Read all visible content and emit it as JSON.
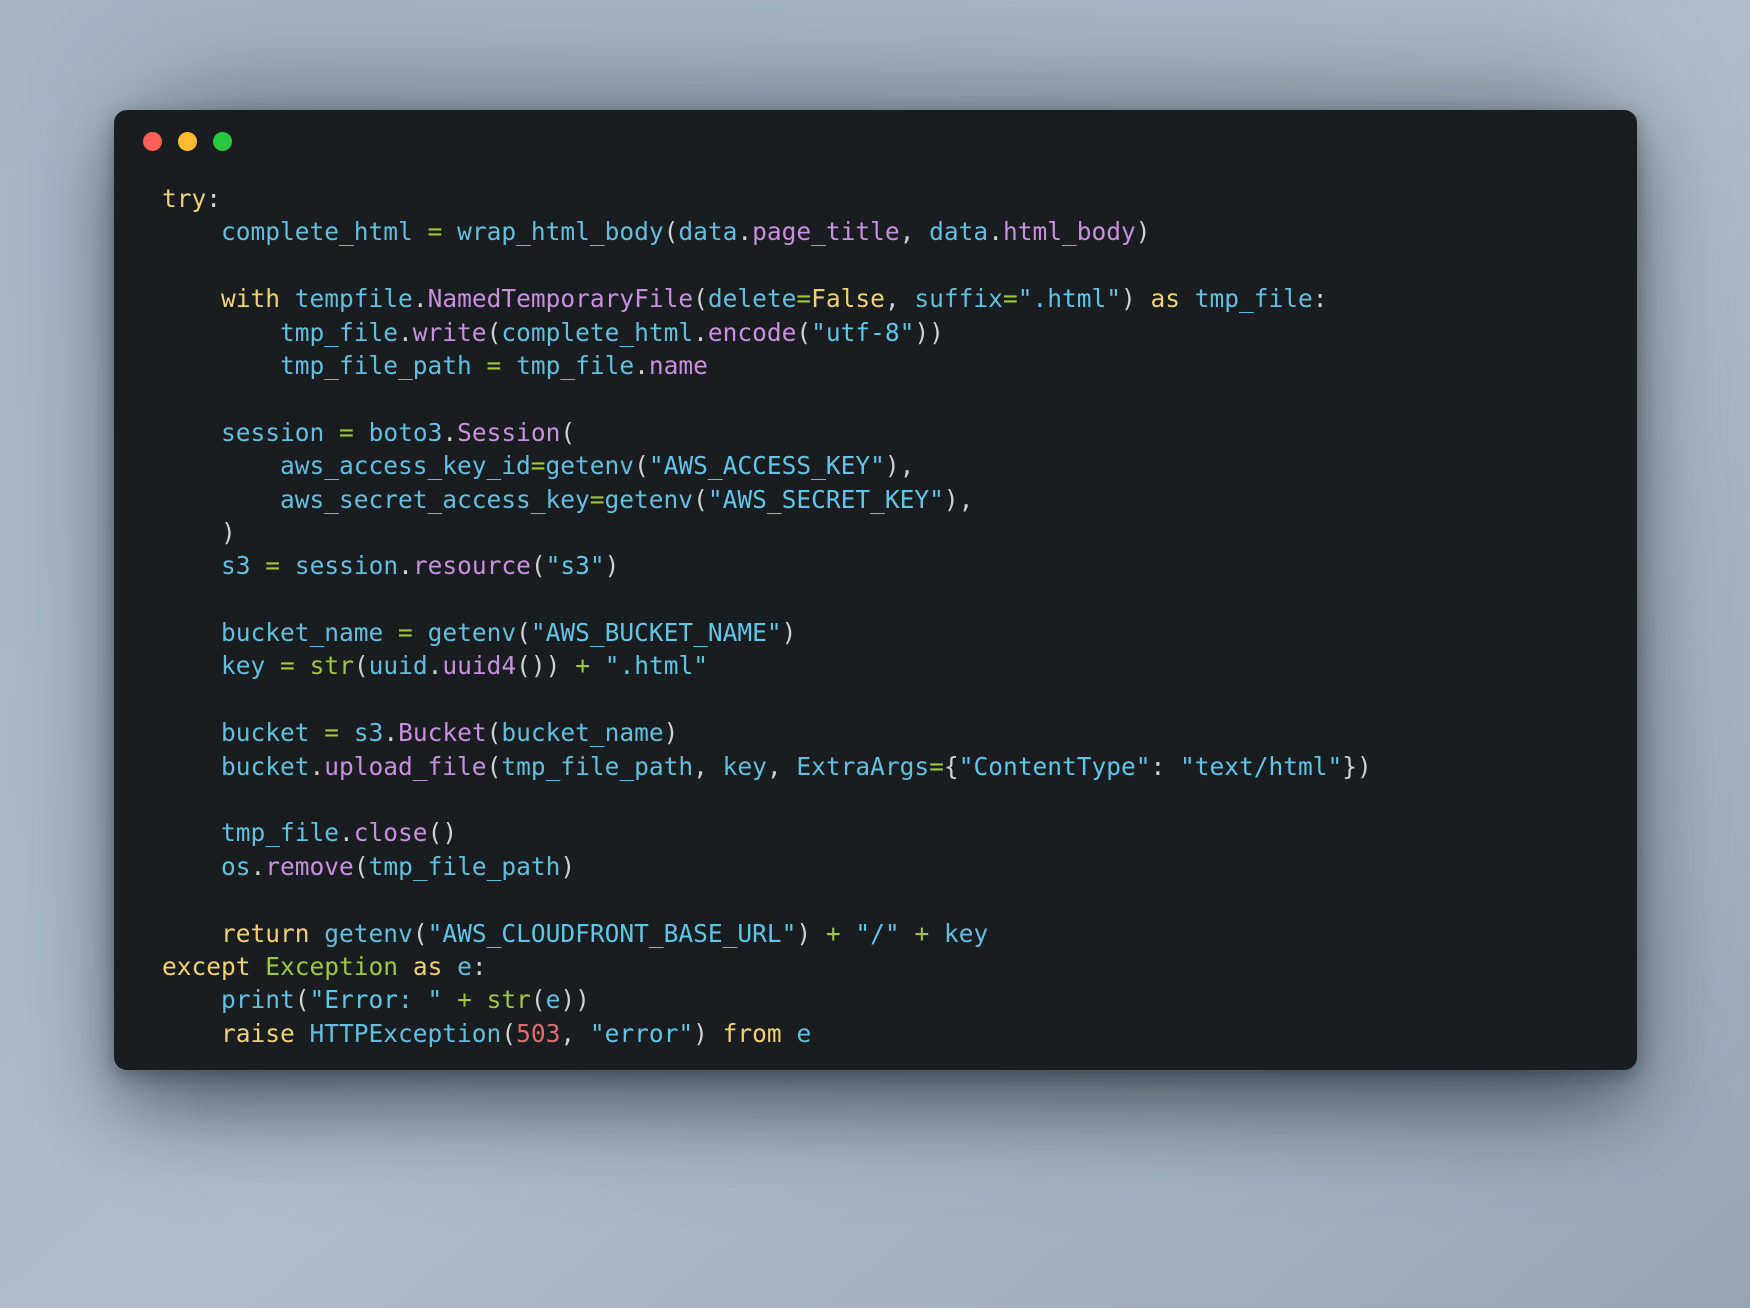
{
  "window": {
    "kind": "code-snippet-window",
    "background_color": "#1a1d1f",
    "page_background_color": "#a9b6c3",
    "traffic_lights": [
      {
        "name": "close",
        "label": "Close",
        "color": "#ff5f57"
      },
      {
        "name": "minimize",
        "label": "Minimize",
        "color": "#febc2e"
      },
      {
        "name": "zoom",
        "label": "Zoom",
        "color": "#28c840"
      }
    ]
  },
  "theme": {
    "keyword": "#f1d175",
    "identifier": "#62bfe0",
    "attribute": "#c98fe0",
    "string": "#5fc6ea",
    "operator": "#9fc93c",
    "builtin": "#9fc93c",
    "number": "#e06c6c",
    "punctuation": "#cfd2d4"
  },
  "code": {
    "language": "python",
    "plain_text": "try:\n    complete_html = wrap_html_body(data.page_title, data.html_body)\n\n    with tempfile.NamedTemporaryFile(delete=False, suffix=\".html\") as tmp_file:\n        tmp_file.write(complete_html.encode(\"utf-8\"))\n        tmp_file_path = tmp_file.name\n\n    session = boto3.Session(\n        aws_access_key_id=getenv(\"AWS_ACCESS_KEY\"),\n        aws_secret_access_key=getenv(\"AWS_SECRET_KEY\"),\n    )\n    s3 = session.resource(\"s3\")\n\n    bucket_name = getenv(\"AWS_BUCKET_NAME\")\n    key = str(uuid.uuid4()) + \".html\"\n\n    bucket = s3.Bucket(bucket_name)\n    bucket.upload_file(tmp_file_path, key, ExtraArgs={\"ContentType\": \"text/html\"})\n\n    tmp_file.close()\n    os.remove(tmp_file_path)\n\n    return getenv(\"AWS_CLOUDFRONT_BASE_URL\") + \"/\" + key\nexcept Exception as e:\n    print(\"Error: \" + str(e))\n    raise HTTPException(503, \"error\") from e",
    "lines": [
      {
        "n": 1,
        "tokens": [
          {
            "t": "kw",
            "v": "try"
          },
          {
            "t": "pun",
            "v": ":"
          }
        ]
      },
      {
        "n": 2,
        "tokens": [
          {
            "t": "pun",
            "v": "    "
          },
          {
            "t": "id",
            "v": "complete_html"
          },
          {
            "t": "pun",
            "v": " "
          },
          {
            "t": "op",
            "v": "="
          },
          {
            "t": "pun",
            "v": " "
          },
          {
            "t": "id",
            "v": "wrap_html_body"
          },
          {
            "t": "pun",
            "v": "("
          },
          {
            "t": "id",
            "v": "data"
          },
          {
            "t": "pun",
            "v": "."
          },
          {
            "t": "attr",
            "v": "page_title"
          },
          {
            "t": "pun",
            "v": ", "
          },
          {
            "t": "id",
            "v": "data"
          },
          {
            "t": "pun",
            "v": "."
          },
          {
            "t": "attr",
            "v": "html_body"
          },
          {
            "t": "pun",
            "v": ")"
          }
        ]
      },
      {
        "n": 3,
        "tokens": []
      },
      {
        "n": 4,
        "tokens": [
          {
            "t": "pun",
            "v": "    "
          },
          {
            "t": "kw",
            "v": "with"
          },
          {
            "t": "pun",
            "v": " "
          },
          {
            "t": "id",
            "v": "tempfile"
          },
          {
            "t": "pun",
            "v": "."
          },
          {
            "t": "attr",
            "v": "NamedTemporaryFile"
          },
          {
            "t": "pun",
            "v": "("
          },
          {
            "t": "id",
            "v": "delete"
          },
          {
            "t": "op",
            "v": "="
          },
          {
            "t": "con",
            "v": "False"
          },
          {
            "t": "pun",
            "v": ", "
          },
          {
            "t": "id",
            "v": "suffix"
          },
          {
            "t": "op",
            "v": "="
          },
          {
            "t": "str",
            "v": "\".html\""
          },
          {
            "t": "pun",
            "v": ")"
          },
          {
            "t": "pun",
            "v": " "
          },
          {
            "t": "kw",
            "v": "as"
          },
          {
            "t": "pun",
            "v": " "
          },
          {
            "t": "id",
            "v": "tmp_file"
          },
          {
            "t": "pun",
            "v": ":"
          }
        ]
      },
      {
        "n": 5,
        "tokens": [
          {
            "t": "pun",
            "v": "        "
          },
          {
            "t": "id",
            "v": "tmp_file"
          },
          {
            "t": "pun",
            "v": "."
          },
          {
            "t": "attr",
            "v": "write"
          },
          {
            "t": "pun",
            "v": "("
          },
          {
            "t": "id",
            "v": "complete_html"
          },
          {
            "t": "pun",
            "v": "."
          },
          {
            "t": "attr",
            "v": "encode"
          },
          {
            "t": "pun",
            "v": "("
          },
          {
            "t": "str",
            "v": "\"utf-8\""
          },
          {
            "t": "pun",
            "v": "))"
          }
        ]
      },
      {
        "n": 6,
        "tokens": [
          {
            "t": "pun",
            "v": "        "
          },
          {
            "t": "id",
            "v": "tmp_file_path"
          },
          {
            "t": "pun",
            "v": " "
          },
          {
            "t": "op",
            "v": "="
          },
          {
            "t": "pun",
            "v": " "
          },
          {
            "t": "id",
            "v": "tmp_file"
          },
          {
            "t": "pun",
            "v": "."
          },
          {
            "t": "attr",
            "v": "name"
          }
        ]
      },
      {
        "n": 7,
        "tokens": []
      },
      {
        "n": 8,
        "tokens": [
          {
            "t": "pun",
            "v": "    "
          },
          {
            "t": "id",
            "v": "session"
          },
          {
            "t": "pun",
            "v": " "
          },
          {
            "t": "op",
            "v": "="
          },
          {
            "t": "pun",
            "v": " "
          },
          {
            "t": "id",
            "v": "boto3"
          },
          {
            "t": "pun",
            "v": "."
          },
          {
            "t": "attr",
            "v": "Session"
          },
          {
            "t": "pun",
            "v": "("
          }
        ]
      },
      {
        "n": 9,
        "tokens": [
          {
            "t": "pun",
            "v": "        "
          },
          {
            "t": "id",
            "v": "aws_access_key_id"
          },
          {
            "t": "op",
            "v": "="
          },
          {
            "t": "id",
            "v": "getenv"
          },
          {
            "t": "pun",
            "v": "("
          },
          {
            "t": "str",
            "v": "\"AWS_ACCESS_KEY\""
          },
          {
            "t": "pun",
            "v": "),"
          }
        ]
      },
      {
        "n": 10,
        "tokens": [
          {
            "t": "pun",
            "v": "        "
          },
          {
            "t": "id",
            "v": "aws_secret_access_key"
          },
          {
            "t": "op",
            "v": "="
          },
          {
            "t": "id",
            "v": "getenv"
          },
          {
            "t": "pun",
            "v": "("
          },
          {
            "t": "str",
            "v": "\"AWS_SECRET_KEY\""
          },
          {
            "t": "pun",
            "v": "),"
          }
        ]
      },
      {
        "n": 11,
        "tokens": [
          {
            "t": "pun",
            "v": "    )"
          }
        ]
      },
      {
        "n": 12,
        "tokens": [
          {
            "t": "pun",
            "v": "    "
          },
          {
            "t": "id",
            "v": "s3"
          },
          {
            "t": "pun",
            "v": " "
          },
          {
            "t": "op",
            "v": "="
          },
          {
            "t": "pun",
            "v": " "
          },
          {
            "t": "id",
            "v": "session"
          },
          {
            "t": "pun",
            "v": "."
          },
          {
            "t": "attr",
            "v": "resource"
          },
          {
            "t": "pun",
            "v": "("
          },
          {
            "t": "str",
            "v": "\"s3\""
          },
          {
            "t": "pun",
            "v": ")"
          }
        ]
      },
      {
        "n": 13,
        "tokens": []
      },
      {
        "n": 14,
        "tokens": [
          {
            "t": "pun",
            "v": "    "
          },
          {
            "t": "id",
            "v": "bucket_name"
          },
          {
            "t": "pun",
            "v": " "
          },
          {
            "t": "op",
            "v": "="
          },
          {
            "t": "pun",
            "v": " "
          },
          {
            "t": "id",
            "v": "getenv"
          },
          {
            "t": "pun",
            "v": "("
          },
          {
            "t": "str",
            "v": "\"AWS_BUCKET_NAME\""
          },
          {
            "t": "pun",
            "v": ")"
          }
        ]
      },
      {
        "n": 15,
        "tokens": [
          {
            "t": "pun",
            "v": "    "
          },
          {
            "t": "id",
            "v": "key"
          },
          {
            "t": "pun",
            "v": " "
          },
          {
            "t": "op",
            "v": "="
          },
          {
            "t": "pun",
            "v": " "
          },
          {
            "t": "bi",
            "v": "str"
          },
          {
            "t": "pun",
            "v": "("
          },
          {
            "t": "id",
            "v": "uuid"
          },
          {
            "t": "pun",
            "v": "."
          },
          {
            "t": "attr",
            "v": "uuid4"
          },
          {
            "t": "pun",
            "v": "())"
          },
          {
            "t": "pun",
            "v": " "
          },
          {
            "t": "op",
            "v": "+"
          },
          {
            "t": "pun",
            "v": " "
          },
          {
            "t": "str",
            "v": "\".html\""
          }
        ]
      },
      {
        "n": 16,
        "tokens": []
      },
      {
        "n": 17,
        "tokens": [
          {
            "t": "pun",
            "v": "    "
          },
          {
            "t": "id",
            "v": "bucket"
          },
          {
            "t": "pun",
            "v": " "
          },
          {
            "t": "op",
            "v": "="
          },
          {
            "t": "pun",
            "v": " "
          },
          {
            "t": "id",
            "v": "s3"
          },
          {
            "t": "pun",
            "v": "."
          },
          {
            "t": "attr",
            "v": "Bucket"
          },
          {
            "t": "pun",
            "v": "("
          },
          {
            "t": "id",
            "v": "bucket_name"
          },
          {
            "t": "pun",
            "v": ")"
          }
        ]
      },
      {
        "n": 18,
        "tokens": [
          {
            "t": "pun",
            "v": "    "
          },
          {
            "t": "id",
            "v": "bucket"
          },
          {
            "t": "pun",
            "v": "."
          },
          {
            "t": "attr",
            "v": "upload_file"
          },
          {
            "t": "pun",
            "v": "("
          },
          {
            "t": "id",
            "v": "tmp_file_path"
          },
          {
            "t": "pun",
            "v": ", "
          },
          {
            "t": "id",
            "v": "key"
          },
          {
            "t": "pun",
            "v": ", "
          },
          {
            "t": "id",
            "v": "ExtraArgs"
          },
          {
            "t": "op",
            "v": "="
          },
          {
            "t": "pun",
            "v": "{"
          },
          {
            "t": "str",
            "v": "\"ContentType\""
          },
          {
            "t": "pun",
            "v": ": "
          },
          {
            "t": "str",
            "v": "\"text/html\""
          },
          {
            "t": "pun",
            "v": "})"
          }
        ]
      },
      {
        "n": 19,
        "tokens": []
      },
      {
        "n": 20,
        "tokens": [
          {
            "t": "pun",
            "v": "    "
          },
          {
            "t": "id",
            "v": "tmp_file"
          },
          {
            "t": "pun",
            "v": "."
          },
          {
            "t": "attr",
            "v": "close"
          },
          {
            "t": "pun",
            "v": "()"
          }
        ]
      },
      {
        "n": 21,
        "tokens": [
          {
            "t": "pun",
            "v": "    "
          },
          {
            "t": "id",
            "v": "os"
          },
          {
            "t": "pun",
            "v": "."
          },
          {
            "t": "attr",
            "v": "remove"
          },
          {
            "t": "pun",
            "v": "("
          },
          {
            "t": "id",
            "v": "tmp_file_path"
          },
          {
            "t": "pun",
            "v": ")"
          }
        ]
      },
      {
        "n": 22,
        "tokens": []
      },
      {
        "n": 23,
        "tokens": [
          {
            "t": "pun",
            "v": "    "
          },
          {
            "t": "kw",
            "v": "return"
          },
          {
            "t": "pun",
            "v": " "
          },
          {
            "t": "id",
            "v": "getenv"
          },
          {
            "t": "pun",
            "v": "("
          },
          {
            "t": "str",
            "v": "\"AWS_CLOUDFRONT_BASE_URL\""
          },
          {
            "t": "pun",
            "v": ")"
          },
          {
            "t": "pun",
            "v": " "
          },
          {
            "t": "op",
            "v": "+"
          },
          {
            "t": "pun",
            "v": " "
          },
          {
            "t": "str",
            "v": "\"/\""
          },
          {
            "t": "pun",
            "v": " "
          },
          {
            "t": "op",
            "v": "+"
          },
          {
            "t": "pun",
            "v": " "
          },
          {
            "t": "id",
            "v": "key"
          }
        ]
      },
      {
        "n": 24,
        "tokens": [
          {
            "t": "kw",
            "v": "except"
          },
          {
            "t": "pun",
            "v": " "
          },
          {
            "t": "bi",
            "v": "Exception"
          },
          {
            "t": "pun",
            "v": " "
          },
          {
            "t": "kw",
            "v": "as"
          },
          {
            "t": "pun",
            "v": " "
          },
          {
            "t": "id",
            "v": "e"
          },
          {
            "t": "pun",
            "v": ":"
          }
        ]
      },
      {
        "n": 25,
        "tokens": [
          {
            "t": "pun",
            "v": "    "
          },
          {
            "t": "id",
            "v": "print"
          },
          {
            "t": "pun",
            "v": "("
          },
          {
            "t": "str",
            "v": "\"Error: \""
          },
          {
            "t": "pun",
            "v": " "
          },
          {
            "t": "op",
            "v": "+"
          },
          {
            "t": "pun",
            "v": " "
          },
          {
            "t": "bi",
            "v": "str"
          },
          {
            "t": "pun",
            "v": "("
          },
          {
            "t": "id",
            "v": "e"
          },
          {
            "t": "pun",
            "v": "))"
          }
        ]
      },
      {
        "n": 26,
        "tokens": [
          {
            "t": "pun",
            "v": "    "
          },
          {
            "t": "kw",
            "v": "raise"
          },
          {
            "t": "pun",
            "v": " "
          },
          {
            "t": "id",
            "v": "HTTPException"
          },
          {
            "t": "pun",
            "v": "("
          },
          {
            "t": "num",
            "v": "503"
          },
          {
            "t": "pun",
            "v": ", "
          },
          {
            "t": "str",
            "v": "\"error\""
          },
          {
            "t": "pun",
            "v": ")"
          },
          {
            "t": "pun",
            "v": " "
          },
          {
            "t": "kw",
            "v": "from"
          },
          {
            "t": "pun",
            "v": " "
          },
          {
            "t": "id",
            "v": "e"
          }
        ]
      }
    ]
  }
}
